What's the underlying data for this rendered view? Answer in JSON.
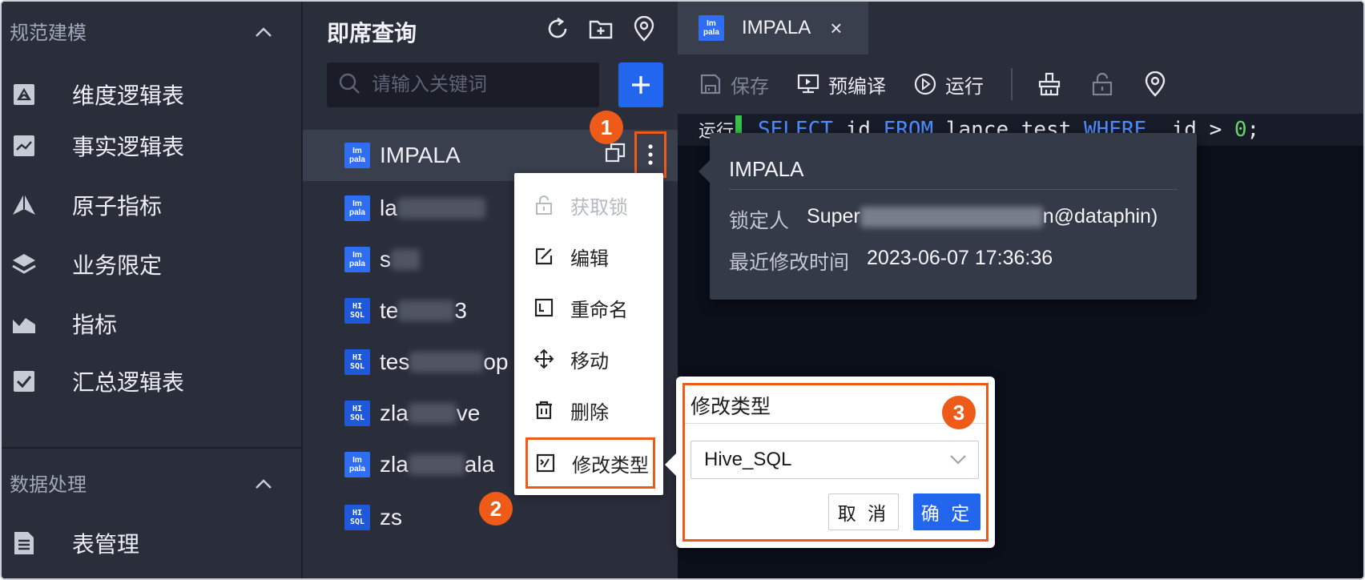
{
  "colors": {
    "accent": "#2266ee",
    "highlight": "#ee5a17",
    "panel_bg": "#2a2e3b",
    "editor_bg": "#0b0f1a"
  },
  "nav": {
    "section1": {
      "label": "规范建模",
      "icon": "chevron-up-icon"
    },
    "items": [
      {
        "label": "维度逻辑表",
        "icon": "dimension-table-icon"
      },
      {
        "label": "事实逻辑表",
        "icon": "fact-table-icon"
      },
      {
        "label": "原子指标",
        "icon": "atomic-metric-icon"
      },
      {
        "label": "业务限定",
        "icon": "layers-icon"
      },
      {
        "label": "指标",
        "icon": "metric-chart-icon"
      },
      {
        "label": "汇总逻辑表",
        "icon": "summary-table-icon"
      }
    ],
    "section2": {
      "label": "数据处理",
      "icon": "chevron-up-icon"
    },
    "items2": [
      {
        "label": "表管理",
        "icon": "table-manage-icon"
      }
    ]
  },
  "panel": {
    "title": "即席查询",
    "search_placeholder": "请输入关键词",
    "add_label": "+",
    "files": [
      {
        "name": "IMPALA",
        "type": "impala",
        "type_label_top": "Im",
        "type_label_bottom": "pala",
        "active": true
      },
      {
        "name": "la",
        "type": "impala",
        "type_label_top": "Im",
        "type_label_bottom": "pala"
      },
      {
        "name": "s",
        "type": "impala",
        "type_label_top": "Im",
        "type_label_bottom": "pala"
      },
      {
        "name": "te",
        "tail": "3",
        "type": "hisql",
        "type_label_top": "HI",
        "type_label_bottom": "SQL"
      },
      {
        "name": "tes",
        "tail": "op",
        "type": "hisql",
        "type_label_top": "HI",
        "type_label_bottom": "SQL"
      },
      {
        "name": "zla",
        "tail": "ve",
        "type": "hisql",
        "type_label_top": "HI",
        "type_label_bottom": "SQL"
      },
      {
        "name": "zla",
        "tail": "ala",
        "type": "impala",
        "type_label_top": "Im",
        "type_label_bottom": "pala"
      },
      {
        "name": "zs",
        "type": "hisql",
        "type_label_top": "HI",
        "type_label_bottom": "SQL"
      }
    ]
  },
  "context_menu": {
    "items": [
      {
        "label": "获取锁",
        "icon": "lock-open-icon",
        "disabled": true
      },
      {
        "label": "编辑",
        "icon": "edit-icon"
      },
      {
        "label": "重命名",
        "icon": "rename-icon"
      },
      {
        "label": "移动",
        "icon": "move-icon"
      },
      {
        "label": "删除",
        "icon": "delete-icon"
      },
      {
        "label": "修改类型",
        "icon": "change-type-icon",
        "highlighted": true
      }
    ]
  },
  "steps": {
    "one": "1",
    "two": "2",
    "three": "3"
  },
  "editor": {
    "tab": {
      "label": "IMPALA",
      "type_label_top": "Im",
      "type_label_bottom": "pala",
      "close": "×"
    },
    "toolbar": {
      "save": "保存",
      "precompile": "预编译",
      "run": "运行"
    },
    "code": {
      "run_label": "运行",
      "tokens": [
        "SELECT",
        " id ",
        "FROM",
        " lance_test ",
        "WHERE",
        "  id > ",
        "0",
        ";"
      ]
    }
  },
  "tooltip": {
    "title": "IMPALA",
    "locker_label": "锁定人",
    "locker_value_prefix": "Super",
    "locker_value_suffix": "n@dataphin)",
    "modified_label": "最近修改时间",
    "modified_value": "2023-06-07 17:36:36"
  },
  "popover": {
    "title": "修改类型",
    "selected": "Hive_SQL",
    "cancel": "取 消",
    "ok": "确 定"
  }
}
